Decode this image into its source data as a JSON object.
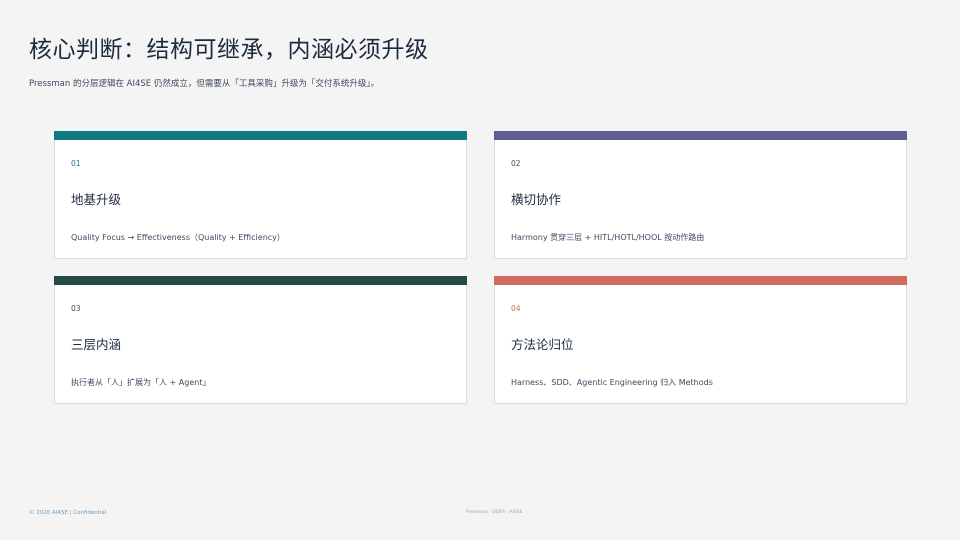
{
  "page": {
    "title": "核心判断：结构可继承，内涵必须升级",
    "subtitle": "Pressman 的分层逻辑在 AI4SE 仍然成立，但需要从「工具采购」升级为「交付系统升级」。"
  },
  "cards": [
    {
      "num": "01",
      "title": "地基升级",
      "desc": "Quality Focus → Effectiveness（Quality + Efficiency）",
      "bar_color": "#0f7a80",
      "num_color": "#2b6f8a"
    },
    {
      "num": "02",
      "title": "横切协作",
      "desc": "Harmony 贯穿三层 + HITL/HOTL/HOOL 按动作路由",
      "bar_color": "#5e5d95",
      "num_color": "#3f4c5e"
    },
    {
      "num": "03",
      "title": "三层内涵",
      "desc": "执行者从「人」扩展为「人 + Agent」",
      "bar_color": "#234a45",
      "num_color": "#3f4c5e"
    },
    {
      "num": "04",
      "title": "方法论归位",
      "desc": "Harness、SDD、Agentic Engineering 归入 Methods",
      "bar_color": "#d46b61",
      "num_color": "#d46b61"
    }
  ],
  "footer": {
    "left": "© 2026  AI4SE  |  Confidential",
    "center": "Pressman · DORA · AI4SE"
  }
}
